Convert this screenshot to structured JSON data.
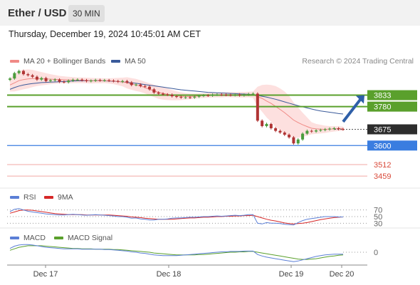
{
  "header": {
    "pair": "Ether / USD",
    "timeframe": "30 MIN",
    "timestamp": "Thursday, December 19, 2024 10:45:01 AM CET"
  },
  "legend": {
    "ma20_label": "MA 20 + Bollinger Bands",
    "ma50_label": "MA 50",
    "research": "Research © 2024 Trading Central",
    "rsi_label": "RSI",
    "rsi_ma_label": "9MA",
    "macd_label": "MACD",
    "macd_signal_label": "MACD Signal"
  },
  "colors": {
    "bollinger_fill": "#fde0df",
    "ma20": "#f08a86",
    "ma50": "#3a5a9a",
    "resistance": "#5aa02c",
    "support": "#3a7de0",
    "target": "#f0a8a4",
    "last": "#2d2d2d",
    "rsi": "#5b7fd6",
    "rsi_ma": "#d62828",
    "macd": "#5b7fd6",
    "macd_signal": "#5aa02c",
    "candle_up": "#4a9c3c",
    "candle_down": "#b03434"
  },
  "chart_data": [
    {
      "type": "candlestick",
      "pane": "price",
      "ylim": [
        3400,
        3960
      ],
      "x_ticks": [
        "Dec 17",
        "Dec 18",
        "Dec 19",
        "Dec 20"
      ],
      "close": [
        3910,
        3935,
        3945,
        3930,
        3925,
        3918,
        3905,
        3912,
        3898,
        3902,
        3905,
        3895,
        3893,
        3900,
        3904,
        3905,
        3902,
        3898,
        3900,
        3903,
        3901,
        3902,
        3900,
        3898,
        3895,
        3898,
        3892,
        3880,
        3882,
        3875,
        3872,
        3860,
        3845,
        3840,
        3836,
        3835,
        3828,
        3825,
        3822,
        3823,
        3822,
        3826,
        3830,
        3832,
        3831,
        3835,
        3836,
        3835,
        3834,
        3833,
        3836,
        3832,
        3835,
        3838,
        3840,
        3715,
        3690,
        3700,
        3680,
        3668,
        3660,
        3650,
        3638,
        3610,
        3628,
        3655,
        3668,
        3665,
        3670,
        3672,
        3675,
        3678,
        3680,
        3676,
        3675
      ],
      "ma20": [
        3880,
        3890,
        3900,
        3905,
        3908,
        3910,
        3910,
        3909,
        3908,
        3907,
        3906,
        3905,
        3904,
        3903,
        3903,
        3902,
        3902,
        3901,
        3900,
        3900,
        3900,
        3900,
        3899,
        3898,
        3896,
        3894,
        3890,
        3885,
        3880,
        3875,
        3868,
        3860,
        3853,
        3846,
        3841,
        3837,
        3833,
        3830,
        3828,
        3827,
        3827,
        3828,
        3830,
        3831,
        3832,
        3833,
        3834,
        3834,
        3835,
        3835,
        3835,
        3835,
        3835,
        3836,
        3835,
        3826,
        3818,
        3806,
        3795,
        3781,
        3767,
        3752,
        3735,
        3718,
        3706,
        3696,
        3688,
        3680,
        3677,
        3676,
        3675,
        3676,
        3677,
        3678,
        3678
      ],
      "bb_upper": [
        3910,
        3930,
        3945,
        3950,
        3952,
        3950,
        3945,
        3940,
        3935,
        3930,
        3926,
        3922,
        3920,
        3918,
        3917,
        3915,
        3915,
        3914,
        3913,
        3912,
        3912,
        3911,
        3911,
        3912,
        3913,
        3914,
        3916,
        3912,
        3908,
        3902,
        3895,
        3888,
        3882,
        3876,
        3870,
        3864,
        3857,
        3851,
        3846,
        3842,
        3840,
        3840,
        3841,
        3842,
        3843,
        3844,
        3845,
        3846,
        3846,
        3847,
        3847,
        3848,
        3848,
        3849,
        3850,
        3872,
        3880,
        3882,
        3880,
        3875,
        3864,
        3850,
        3830,
        3800,
        3776,
        3752,
        3730,
        3708,
        3700,
        3696,
        3692,
        3690,
        3689,
        3689,
        3688
      ],
      "bb_lower": [
        3850,
        3850,
        3855,
        3860,
        3864,
        3870,
        3875,
        3878,
        3881,
        3884,
        3886,
        3888,
        3888,
        3888,
        3889,
        3889,
        3889,
        3888,
        3887,
        3888,
        3888,
        3889,
        3887,
        3884,
        3879,
        3874,
        3864,
        3858,
        3852,
        3848,
        3841,
        3832,
        3824,
        3816,
        3812,
        3810,
        3809,
        3809,
        3810,
        3812,
        3814,
        3816,
        3819,
        3820,
        3821,
        3822,
        3823,
        3822,
        3824,
        3823,
        3823,
        3822,
        3822,
        3823,
        3820,
        3780,
        3756,
        3730,
        3710,
        3687,
        3670,
        3654,
        3640,
        3636,
        3636,
        3640,
        3646,
        3652,
        3654,
        3656,
        3658,
        3662,
        3665,
        3667,
        3668
      ],
      "ma50": [
        3860,
        3868,
        3875,
        3880,
        3884,
        3887,
        3889,
        3891,
        3892,
        3893,
        3894,
        3895,
        3896,
        3897,
        3898,
        3899,
        3899,
        3900,
        3900,
        3900,
        3900,
        3899,
        3898,
        3897,
        3896,
        3894,
        3892,
        3890,
        3888,
        3885,
        3882,
        3879,
        3876,
        3873,
        3870,
        3867,
        3864,
        3861,
        3858,
        3856,
        3854,
        3852,
        3850,
        3848,
        3846,
        3845,
        3844,
        3843,
        3842,
        3841,
        3840,
        3839,
        3838,
        3837,
        3836,
        3832,
        3828,
        3824,
        3819,
        3814,
        3808,
        3802,
        3796,
        3790,
        3784,
        3779,
        3774,
        3769,
        3764,
        3760,
        3757,
        3754,
        3751,
        3748,
        3746
      ],
      "levels": [
        {
          "value": 3833,
          "label": "3833",
          "kind": "resistance"
        },
        {
          "value": 3780,
          "label": "3780",
          "kind": "resistance"
        },
        {
          "value": 3675,
          "label": "3675",
          "kind": "last"
        },
        {
          "value": 3600,
          "label": "3600",
          "kind": "support"
        },
        {
          "value": 3512,
          "label": "3512",
          "kind": "target"
        },
        {
          "value": 3459,
          "label": "3459",
          "kind": "target"
        }
      ],
      "forecast_arrow": {
        "from": 3710,
        "to": 3833
      }
    },
    {
      "type": "line",
      "pane": "rsi",
      "ylim": [
        20,
        80
      ],
      "levels": [
        "70",
        "50",
        "30"
      ],
      "series": [
        {
          "name": "RSI",
          "values": [
            65,
            72,
            74,
            70,
            66,
            64,
            62,
            60,
            58,
            57,
            56,
            55,
            55,
            56,
            57,
            56,
            55,
            54,
            55,
            56,
            55,
            54,
            53,
            52,
            50,
            50,
            48,
            45,
            46,
            43,
            42,
            40,
            40,
            42,
            42,
            43,
            45,
            46,
            46,
            47,
            48,
            48,
            49,
            50,
            50,
            51,
            52,
            51,
            52,
            53,
            54,
            53,
            54,
            56,
            56,
            30,
            28,
            32,
            30,
            30,
            29,
            27,
            26,
            25,
            32,
            38,
            42,
            44,
            46,
            48,
            50,
            50,
            50,
            49,
            49
          ]
        },
        {
          "name": "9MA",
          "values": [
            60,
            64,
            68,
            70,
            70,
            69,
            67,
            65,
            63,
            61,
            59,
            58,
            57,
            56,
            56,
            56,
            56,
            55,
            55,
            55,
            55,
            55,
            55,
            54,
            53,
            52,
            51,
            49,
            48,
            47,
            45,
            44,
            43,
            42,
            42,
            42,
            42,
            43,
            44,
            45,
            46,
            46,
            47,
            48,
            48,
            49,
            50,
            50,
            51,
            51,
            52,
            52,
            53,
            53,
            54,
            50,
            46,
            42,
            39,
            37,
            34,
            31,
            29,
            28,
            29,
            30,
            32,
            35,
            38,
            41,
            43,
            45,
            47,
            48,
            49
          ]
        }
      ]
    },
    {
      "type": "line",
      "pane": "macd",
      "ylim": [
        -30,
        30
      ],
      "levels": [
        "0"
      ],
      "series": [
        {
          "name": "MACD",
          "values": [
            10,
            16,
            19,
            20,
            20,
            19,
            17,
            15,
            13,
            12,
            11,
            10,
            9,
            9,
            9,
            9,
            8,
            8,
            8,
            8,
            8,
            7,
            7,
            6,
            5,
            4,
            3,
            1,
            0,
            -2,
            -3,
            -5,
            -7,
            -8,
            -9,
            -9,
            -9,
            -9,
            -8,
            -7,
            -6,
            -5,
            -4,
            -3,
            -2,
            -1,
            0,
            1,
            1,
            2,
            2,
            2,
            3,
            3,
            3,
            -6,
            -10,
            -13,
            -15,
            -17,
            -19,
            -21,
            -23,
            -25,
            -23,
            -20,
            -17,
            -14,
            -11,
            -9,
            -7,
            -6,
            -5,
            -5,
            -5
          ]
        },
        {
          "name": "MACD Signal",
          "values": [
            5,
            9,
            13,
            15,
            17,
            17,
            17,
            17,
            16,
            15,
            14,
            13,
            12,
            11,
            10,
            10,
            9,
            9,
            9,
            8,
            8,
            8,
            8,
            7,
            7,
            6,
            5,
            4,
            3,
            2,
            1,
            0,
            -2,
            -3,
            -4,
            -5,
            -6,
            -7,
            -7,
            -7,
            -7,
            -7,
            -6,
            -6,
            -5,
            -4,
            -3,
            -2,
            -1,
            0,
            0,
            1,
            1,
            2,
            2,
            0,
            -2,
            -4,
            -6,
            -8,
            -10,
            -12,
            -14,
            -16,
            -18,
            -19,
            -19,
            -18,
            -17,
            -15,
            -13,
            -11,
            -10,
            -8,
            -7
          ]
        }
      ]
    }
  ]
}
